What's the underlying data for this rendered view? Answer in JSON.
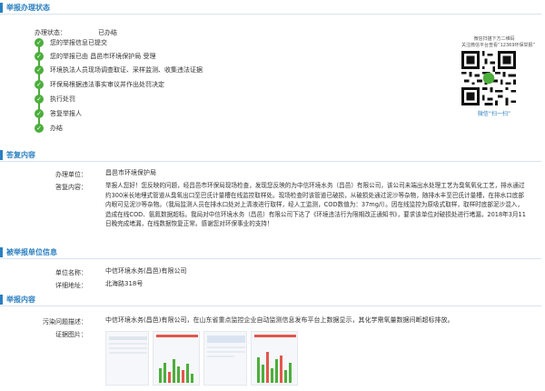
{
  "status_section": {
    "title": "举报办理状态",
    "status_label": "办理状态：",
    "status_value": "已办结",
    "steps": [
      "您的举报信息已提交",
      "您的举报已由 昌邑市环境保护局 受理",
      "环境执法人员现场调查取证、采样监测、收集违法证据",
      "环保局根据违法事实审议并作出处罚决定",
      "执行处罚",
      "答复举报人",
      "办结"
    ]
  },
  "qr": {
    "caption_line1": "微信扫描下方二维码",
    "caption_line2": "关注微信平台查看“12369环保举报”",
    "scan_label": "微信“扫一扫”"
  },
  "reply_section": {
    "title": "答复内容",
    "unit_label": "办理单位：",
    "unit_value": "昌邑市环境保护局",
    "content_label": "答复内容：",
    "content_value": "举报人您好！您反映的问题，经昌邑市环保局现场检查，发现您反映的为中信环境水务（昌邑）有限公司，该公司未端出水处理工艺为臭氧氧化工艺，排水通过约300米长地埋式管道从臭氧出口至巴氏计量槽在线监控取样处。现场检查时该管道已破损，从破损处通过泥沙等杂物，随排水丰至巴氏计量槽，在排水口底部内眼可见泥沙等杂物。（我局监测人员在排水口处对上清液进行取样，经人工监测，COD数值为：37mg/l）。因在线监控为原吸式取样，取样时底部泥沙混入，造成在线COD、氨氮数据超标。我局对中信环境水务（昌邑）有限公司下达了《环境违法行为限期改正通知书》，要求该单位对破损处进行堵漏，2018年3月11日晚完成堵漏，在线数据恢复正常。感谢您对环保事业的支持！"
  },
  "reported_section": {
    "title": "被举报单位信息",
    "unit_label": "单位名称：",
    "unit_value": "中信环境水务(昌邑)有限公司",
    "address_label": "详细地址：",
    "address_value": "北海路318号"
  },
  "report_section": {
    "title": "举报内容",
    "issue_label": "污染问题描述：",
    "issue_value": "中信环境水务(昌邑)有限公司，在山东省重点监控企业自动监测信息发布平台上数据显示，其化学需氧量数据间断超标排放。",
    "evidence_label": "证据图片："
  },
  "colors": {
    "accent": "#2a7fc1",
    "done": "#4cae3c"
  }
}
